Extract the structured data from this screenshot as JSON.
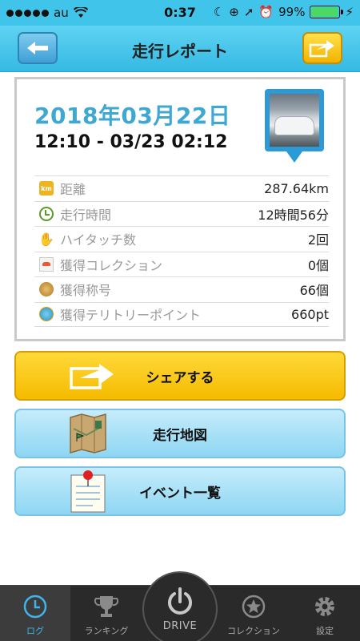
{
  "status_bar": {
    "carrier": "au",
    "time": "0:37",
    "battery": "99%",
    "battery_level": 0.99
  },
  "nav": {
    "title": "走行レポート",
    "back_icon": "arrow-left-icon",
    "share_icon": "share-arrow-icon"
  },
  "report": {
    "date": "2018年03月22日",
    "time_range": "12:10 - 03/23 02:12",
    "stats": [
      {
        "icon": "km-icon",
        "label": "距離",
        "value": "287.64km"
      },
      {
        "icon": "clock-icon",
        "label": "走行時間",
        "value": "12時間56分"
      },
      {
        "icon": "hand-icon",
        "label": "ハイタッチ数",
        "value": "2回"
      },
      {
        "icon": "collection-icon",
        "label": "獲得コレクション",
        "value": "0個"
      },
      {
        "icon": "title-medal-icon",
        "label": "獲得称号",
        "value": "66個"
      },
      {
        "icon": "territory-icon",
        "label": "獲得テリトリーポイント",
        "value": "660pt"
      }
    ]
  },
  "actions": {
    "share": "シェアする",
    "map": "走行地図",
    "events": "イベント一覧"
  },
  "tabs": [
    {
      "label": "ログ",
      "icon": "log-clock-icon",
      "active": true
    },
    {
      "label": "ランキング",
      "icon": "trophy-icon",
      "active": false
    },
    {
      "label": "DRIVE",
      "icon": "power-icon",
      "active": false
    },
    {
      "label": "コレクション",
      "icon": "star-icon",
      "active": false
    },
    {
      "label": "設定",
      "icon": "gear-icon",
      "active": false
    }
  ],
  "colors": {
    "header": "#41c4ea",
    "date_text": "#3fa8d1",
    "share_button": "#f5bb00",
    "sub_button": "#8ed6f3",
    "tab_active": "#3fb4ea"
  }
}
